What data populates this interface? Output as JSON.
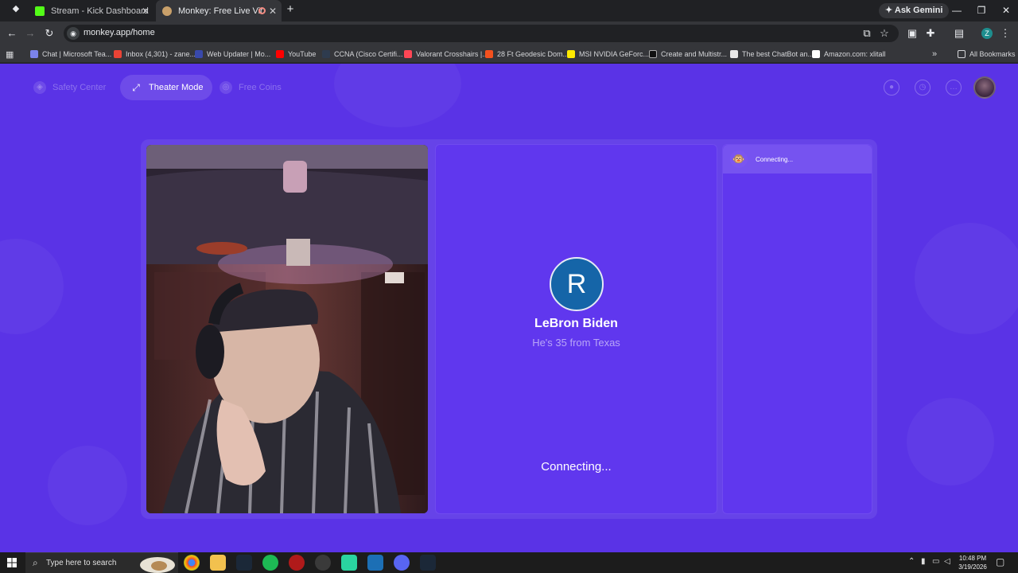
{
  "tabs": [
    {
      "title": "Stream - Kick Dashboard",
      "active": false
    },
    {
      "title": "Monkey: Free Live Video Ch",
      "active": true
    }
  ],
  "ask_gemini": "Ask Gemini",
  "url": "monkey.app/home",
  "profile_initial": "Z",
  "bookmarks": [
    {
      "label": "Chat | Microsoft Tea..."
    },
    {
      "label": "Inbox (4,301) - zane..."
    },
    {
      "label": "Web Updater | Mo..."
    },
    {
      "label": "YouTube"
    },
    {
      "label": "CCNA (Cisco Certifi..."
    },
    {
      "label": "Valorant Crosshairs |..."
    },
    {
      "label": "28 Ft Geodesic Dom..."
    },
    {
      "label": "MSI NVIDIA GeForc..."
    },
    {
      "label": "Create and Multistr..."
    },
    {
      "label": "The best ChatBot an..."
    },
    {
      "label": "Amazon.com: xlitall"
    }
  ],
  "all_bookmarks": "All Bookmarks",
  "nav": {
    "safety_center": "Safety Center",
    "theater_mode": "Theater Mode",
    "free_coins": "Free Coins"
  },
  "partner": {
    "initial": "R",
    "name": "LeBron Biden",
    "info": "He's 35 from Texas",
    "status": "Connecting..."
  },
  "chat": {
    "header": "Connecting..."
  },
  "taskbar": {
    "search_placeholder": "Type here to search",
    "time": "10:48 PM",
    "date": "3/19/2026"
  },
  "colors": {
    "page_bg": "#5a33e6",
    "panel_bg": "#6037ee",
    "avatar_bg": "#1565a8"
  }
}
